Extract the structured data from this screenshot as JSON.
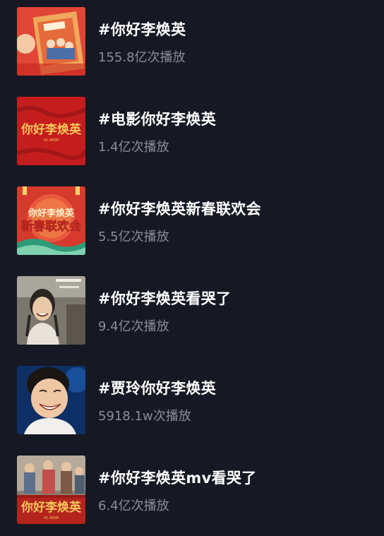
{
  "topics": [
    {
      "title": "#你好李焕英",
      "plays": "155.8亿次播放",
      "thumb_art": "poster-red-movie-icon",
      "colors": {
        "bg": "#e23b2e",
        "accent": "#f2b24a"
      }
    },
    {
      "title": "#电影你好李焕英",
      "plays": "1.4亿次播放",
      "thumb_art": "red-title-card-icon",
      "thumb_text": {
        "main": "你好李焕英",
        "sub": "HI, MOM"
      },
      "colors": {
        "bg": "#c51d1d",
        "accent": "#f4c85a"
      }
    },
    {
      "title": "#你好李焕英新春联欢会",
      "plays": "5.5亿次播放",
      "thumb_art": "gala-logo-icon",
      "thumb_text": {
        "main": "你好李焕英",
        "sub": "新春联欢会"
      },
      "colors": {
        "bg": "#d63a2c",
        "accent": "#f6d36b"
      }
    },
    {
      "title": "#你好李焕英看哭了",
      "plays": "9.4亿次播放",
      "thumb_art": "smiling-woman-photo-icon",
      "colors": {
        "bg": "#6e6a62",
        "accent": "#e9e5dc"
      }
    },
    {
      "title": "#贾玲你好李焕英",
      "plays": "5918.1w次播放",
      "thumb_art": "laughing-woman-stage-icon",
      "colors": {
        "bg": "#123d7a",
        "accent": "#f0c9a8"
      }
    },
    {
      "title": "#你好李焕英mv看哭了",
      "plays": "6.4亿次播放",
      "thumb_art": "group-photo-title-icon",
      "thumb_text": {
        "main": "你好李焕英",
        "sub": "HI, MOM"
      },
      "colors": {
        "bg": "#9a2a22",
        "accent": "#f4c85a"
      }
    }
  ]
}
